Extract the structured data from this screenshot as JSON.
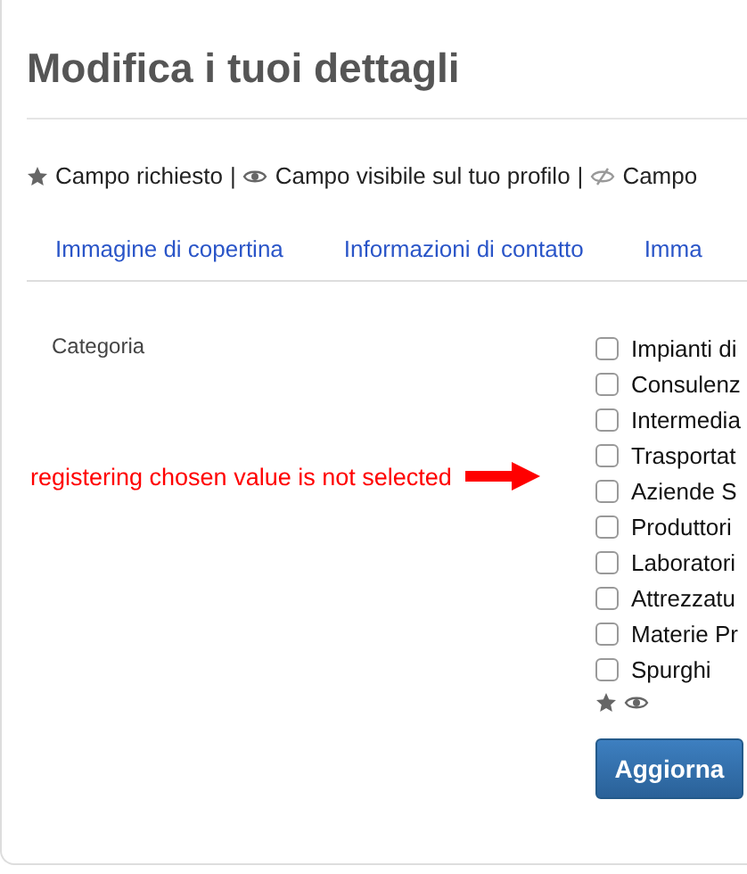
{
  "title": "Modifica i tuoi dettagli",
  "legend": {
    "separator": "|",
    "items": [
      {
        "kind": "required",
        "text": "Campo richiesto"
      },
      {
        "kind": "visible",
        "text": "Campo visibile sul tuo profilo"
      },
      {
        "kind": "hidden",
        "text": "Campo"
      }
    ]
  },
  "tabs": [
    {
      "label": "Immagine di copertina",
      "selected": false
    },
    {
      "label": "Informazioni di contatto",
      "selected": false
    },
    {
      "label": "Imma",
      "selected": false
    }
  ],
  "field": {
    "label": "Categoria",
    "options": [
      {
        "label": "Impianti di",
        "checked": false
      },
      {
        "label": "Consulenz",
        "checked": false
      },
      {
        "label": "Intermedia",
        "checked": false
      },
      {
        "label": "Trasportat",
        "checked": false
      },
      {
        "label": "Aziende S",
        "checked": false
      },
      {
        "label": "Produttori",
        "checked": false
      },
      {
        "label": "Laboratori",
        "checked": false
      },
      {
        "label": "Attrezzatu",
        "checked": false
      },
      {
        "label": "Materie Pr",
        "checked": false
      },
      {
        "label": "Spurghi",
        "checked": false
      }
    ]
  },
  "annotation": "registering chosen value is not selected",
  "submit": "Aggiorna"
}
